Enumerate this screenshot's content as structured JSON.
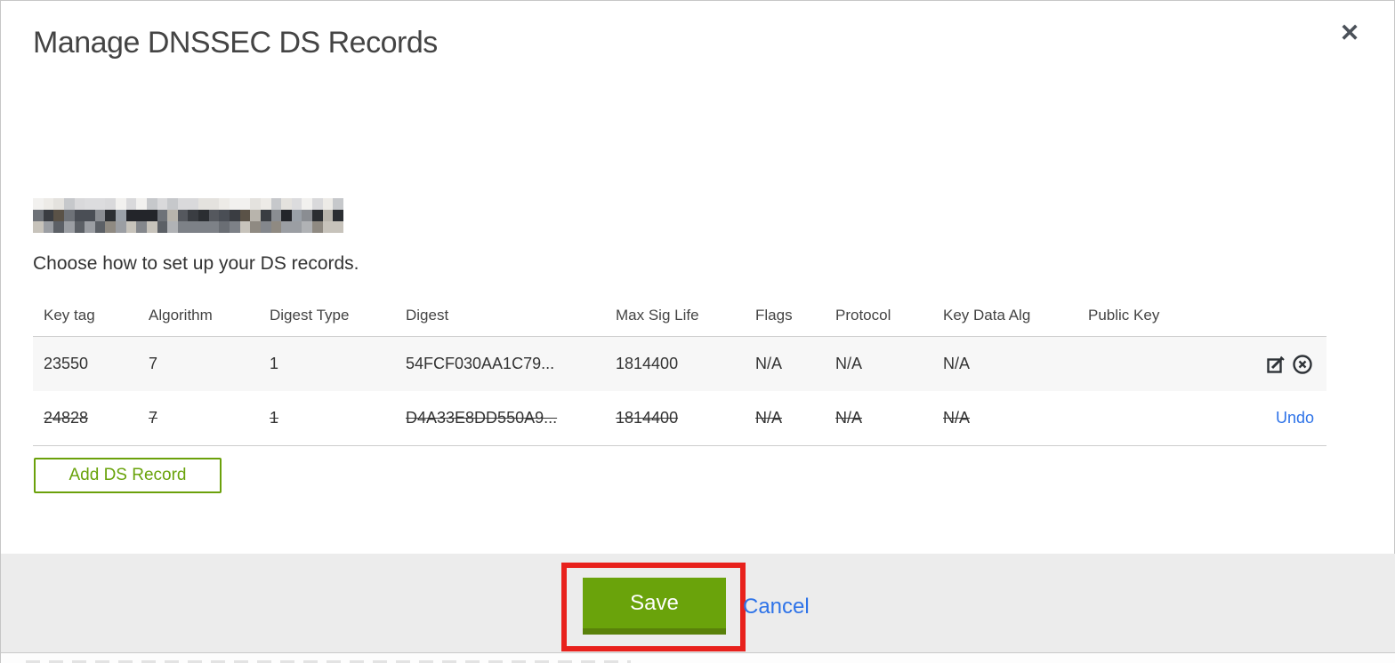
{
  "dialog": {
    "title": "Manage DNSSEC DS Records",
    "close_icon": "✕",
    "instruction": "Choose how to set up your DS records."
  },
  "redacted_domain": {
    "cols": 30,
    "palette_rows": [
      [
        "#f2f1ef",
        "#e4e2de",
        "#d9d9db",
        "#c6c8cb",
        "#edebe7",
        "#dcdcde"
      ],
      [
        "#3a3d42",
        "#55585e",
        "#2b2e32",
        "#6e7278",
        "#8a8d92",
        "#4a4e55",
        "#9aa0a8",
        "#23252a",
        "#b8b4ac",
        "#5a5247"
      ],
      [
        "#7d8187",
        "#9b9ea3",
        "#6a6e74",
        "#b0b2b5",
        "#8f8a82",
        "#5c6066",
        "#c7c3bb",
        "#84878c"
      ]
    ]
  },
  "table": {
    "columns": [
      "Key tag",
      "Algorithm",
      "Digest Type",
      "Digest",
      "Max Sig Life",
      "Flags",
      "Protocol",
      "Key Data Alg",
      "Public Key"
    ],
    "rows": [
      {
        "key_tag": "23550",
        "algorithm": "7",
        "digest_type": "1",
        "digest": "54FCF030AA1C79...",
        "max_sig_life": "1814400",
        "flags": "N/A",
        "protocol": "N/A",
        "key_data_alg": "N/A",
        "public_key": "",
        "state": "normal"
      },
      {
        "key_tag": "24828",
        "algorithm": "7",
        "digest_type": "1",
        "digest": "D4A33E8DD550A9...",
        "max_sig_life": "1814400",
        "flags": "N/A",
        "protocol": "N/A",
        "key_data_alg": "N/A",
        "public_key": "",
        "state": "deleted",
        "undo_label": "Undo"
      }
    ]
  },
  "buttons": {
    "add_ds_record": "Add DS Record",
    "save": "Save",
    "cancel": "Cancel"
  },
  "colors": {
    "accent_green": "#6aa30b",
    "accent_green_dark": "#59810a",
    "outline_green": "#6ba10b",
    "link_blue": "#2e73e8",
    "annotation_red": "#e8211c",
    "footer_gray": "#ececec",
    "row_alt_gray": "#f7f7f7",
    "border_gray": "#cccccc",
    "text_dark": "#333333",
    "icon_dark": "#2f3338"
  }
}
